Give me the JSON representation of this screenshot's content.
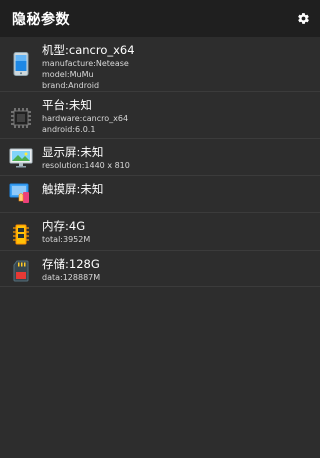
{
  "app": {
    "title": "隐秘参数"
  },
  "icons": {
    "settings": "gear-icon"
  },
  "items": [
    {
      "icon": "phone-icon",
      "label": "机型:cancro_x64",
      "details": [
        "manufacture:Netease",
        "model:MuMu",
        "brand:Android"
      ]
    },
    {
      "icon": "chip-icon",
      "label": "平台:未知",
      "details": [
        "hardware:cancro_x64",
        "android:6.0.1"
      ]
    },
    {
      "icon": "monitor-icon",
      "label": "显示屏:未知",
      "details": [
        "resolution:1440 x 810"
      ]
    },
    {
      "icon": "touch-icon",
      "label": "触摸屏:未知",
      "details": []
    },
    {
      "icon": "memory-icon",
      "label": "内存:4G",
      "details": [
        "total:3952M"
      ]
    },
    {
      "icon": "sdcard-icon",
      "label": "存储:128G",
      "details": [
        "data:128887M"
      ]
    }
  ],
  "colors": {
    "background": "#2d2d2d",
    "topbar": "#1f1f1f",
    "divider": "#3b3b3b"
  }
}
